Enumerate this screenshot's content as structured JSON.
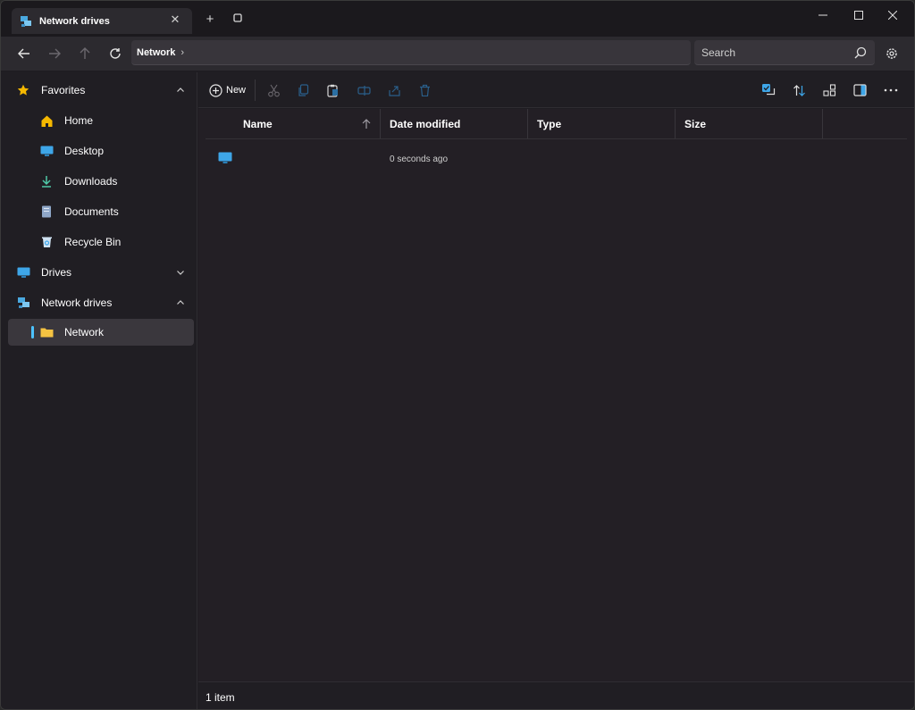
{
  "tab": {
    "title": "Network drives",
    "close_glyph": "✕"
  },
  "titlebar": {
    "new_tab_glyph": "+",
    "minimize_glyph": "—",
    "maximize_glyph": "☐",
    "close_glyph": "✕"
  },
  "address": {
    "crumb": "Network",
    "separator": "›"
  },
  "search": {
    "placeholder": "Search"
  },
  "sidebar": {
    "items": [
      {
        "label": "Favorites",
        "icon": "star-icon"
      },
      {
        "label": "Home",
        "icon": "home-icon"
      },
      {
        "label": "Desktop",
        "icon": "desktop-icon"
      },
      {
        "label": "Downloads",
        "icon": "download-icon"
      },
      {
        "label": "Documents",
        "icon": "document-icon"
      },
      {
        "label": "Recycle Bin",
        "icon": "recycle-bin-icon"
      },
      {
        "label": "Drives",
        "icon": "drive-icon"
      },
      {
        "label": "Network drives",
        "icon": "network-icon"
      },
      {
        "label": "Network",
        "icon": "folder-icon"
      }
    ]
  },
  "toolbar": {
    "new_label": "New"
  },
  "columns": {
    "name": "Name",
    "date": "Date modified",
    "type": "Type",
    "size": "Size"
  },
  "files": [
    {
      "name": "",
      "date_modified": "0 seconds ago",
      "type": "",
      "size": ""
    }
  ],
  "status": {
    "text": "1 item"
  },
  "colors": {
    "accent": "#4cc2ff",
    "folder": "#f5c342",
    "star": "#f5b800"
  }
}
